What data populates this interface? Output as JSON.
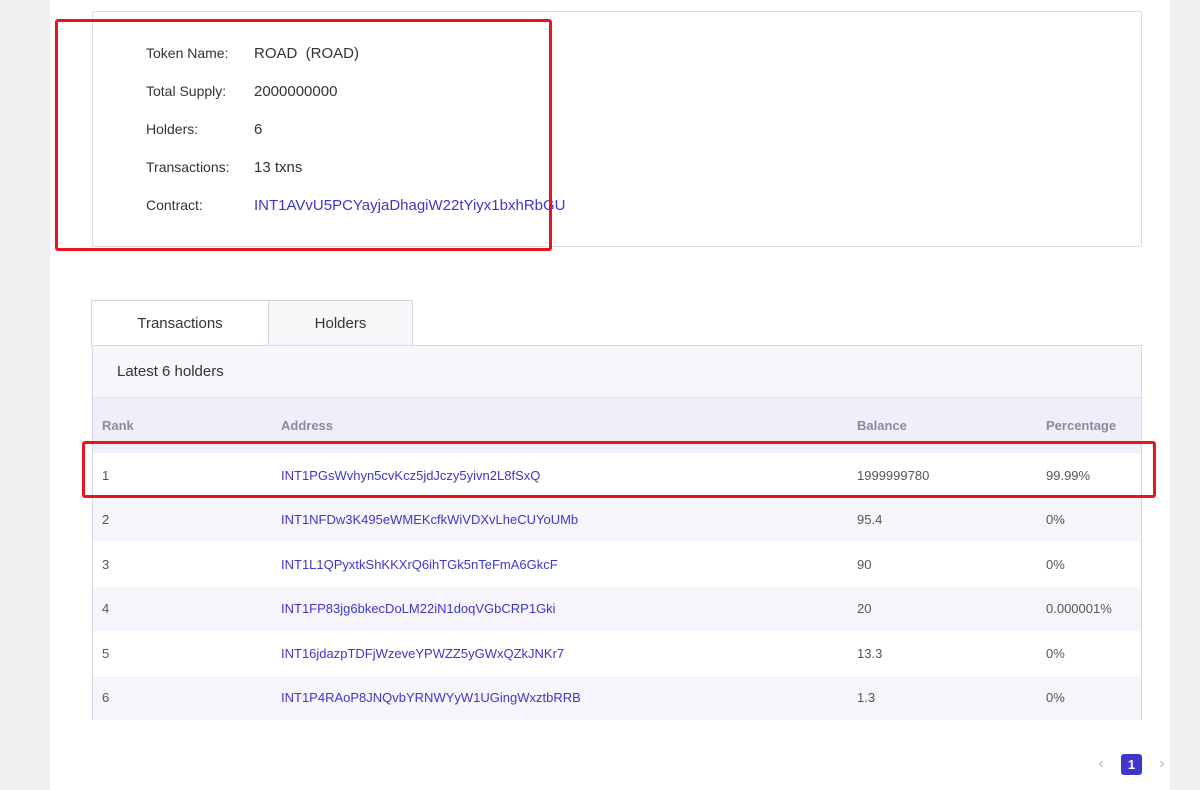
{
  "token_info": {
    "name_label": "Token Name:",
    "name_value": "ROAD  (ROAD)",
    "supply_label": "Total Supply:",
    "supply_value": "2000000000",
    "holders_label": "Holders:",
    "holders_value": "6",
    "transactions_label": "Transactions:",
    "transactions_value": "13 txns",
    "contract_label": "Contract:",
    "contract_value": "INT1AVvU5PCYayjaDhagiW22tYiyx1bxhRbGU"
  },
  "tabs": [
    {
      "label": "Transactions"
    },
    {
      "label": "Holders"
    }
  ],
  "holders": {
    "heading": "Latest 6 holders",
    "columns": {
      "rank": "Rank",
      "address": "Address",
      "balance": "Balance",
      "percentage": "Percentage"
    },
    "rows": [
      {
        "rank": "1",
        "address": "INT1PGsWvhyn5cvKcz5jdJczy5yivn2L8fSxQ",
        "balance": "1999999780",
        "percentage": "99.99%"
      },
      {
        "rank": "2",
        "address": "INT1NFDw3K495eWMEKcfkWiVDXvLheCUYoUMb",
        "balance": "95.4",
        "percentage": "0%"
      },
      {
        "rank": "3",
        "address": "INT1L1QPyxtkShKKXrQ6ihTGk5nTeFmA6GkcF",
        "balance": "90",
        "percentage": "0%"
      },
      {
        "rank": "4",
        "address": "INT1FP83jg6bkecDoLM22iN1doqVGbCRP1Gki",
        "balance": "20",
        "percentage": "0.000001%"
      },
      {
        "rank": "5",
        "address": "INT16jdazpTDFjWzeveYPWZZ5yGWxQZkJNKr7",
        "balance": "13.3",
        "percentage": "0%"
      },
      {
        "rank": "6",
        "address": "INT1P4RAoP8JNQvbYRNWYyW1UGingWxztbRRB",
        "balance": "1.3",
        "percentage": "0%"
      }
    ]
  },
  "pagination": {
    "prev_icon": "chevron-left-icon",
    "current": "1",
    "next_icon": "chevron-right-icon"
  },
  "colors": {
    "accent": "#3f37c9",
    "highlight": "#e8141e"
  }
}
